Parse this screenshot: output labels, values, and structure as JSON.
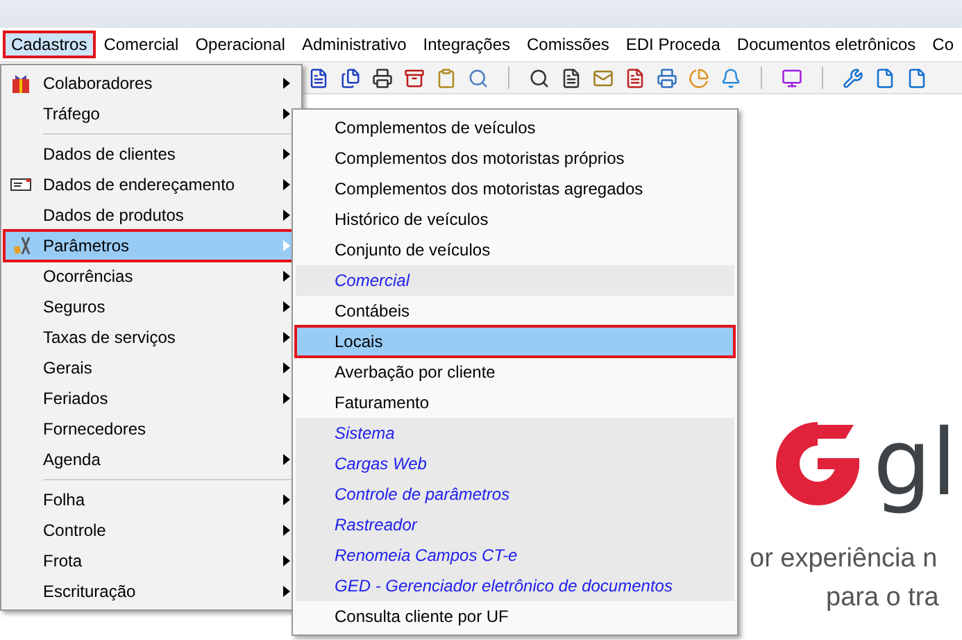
{
  "menubar": [
    {
      "label": "Cadastros",
      "selected": true
    },
    {
      "label": "Comercial",
      "selected": false
    },
    {
      "label": "Operacional",
      "selected": false
    },
    {
      "label": "Administrativo",
      "selected": false
    },
    {
      "label": "Integrações",
      "selected": false
    },
    {
      "label": "Comissões",
      "selected": false
    },
    {
      "label": "EDI Proceda",
      "selected": false
    },
    {
      "label": "Documentos eletrônicos",
      "selected": false
    },
    {
      "label": "Co",
      "selected": false
    }
  ],
  "menu": [
    {
      "kind": "item",
      "label": "Colaboradores",
      "submenu": true,
      "selected": false
    },
    {
      "kind": "item",
      "label": "Tráfego",
      "submenu": true,
      "selected": false
    },
    {
      "kind": "separator"
    },
    {
      "kind": "item",
      "label": "Dados de clientes",
      "submenu": true,
      "selected": false
    },
    {
      "kind": "item",
      "label": "Dados de endereçamento",
      "submenu": true,
      "selected": false
    },
    {
      "kind": "item",
      "label": "Dados de produtos",
      "submenu": true,
      "selected": false
    },
    {
      "kind": "item",
      "label": "Parâmetros",
      "submenu": true,
      "selected": true
    },
    {
      "kind": "item",
      "label": "Ocorrências",
      "submenu": true,
      "selected": false
    },
    {
      "kind": "item",
      "label": "Seguros",
      "submenu": true,
      "selected": false
    },
    {
      "kind": "item",
      "label": "Taxas de serviços",
      "submenu": true,
      "selected": false
    },
    {
      "kind": "item",
      "label": "Gerais",
      "submenu": true,
      "selected": false
    },
    {
      "kind": "item",
      "label": "Feriados",
      "submenu": true,
      "selected": false
    },
    {
      "kind": "item",
      "label": "Fornecedores",
      "submenu": false,
      "selected": false
    },
    {
      "kind": "item",
      "label": "Agenda",
      "submenu": true,
      "selected": false
    },
    {
      "kind": "separator"
    },
    {
      "kind": "item",
      "label": "Folha",
      "submenu": true,
      "selected": false
    },
    {
      "kind": "item",
      "label": "Controle",
      "submenu": true,
      "selected": false
    },
    {
      "kind": "item",
      "label": "Frota",
      "submenu": true,
      "selected": false
    },
    {
      "kind": "item",
      "label": "Escrituração",
      "submenu": true,
      "selected": false
    }
  ],
  "submenu": [
    {
      "kind": "item",
      "label": "Complementos de veículos",
      "selected": false
    },
    {
      "kind": "item",
      "label": "Complementos dos motoristas próprios",
      "selected": false
    },
    {
      "kind": "item",
      "label": "Complementos dos motoristas agregados",
      "selected": false
    },
    {
      "kind": "item",
      "label": "Histórico de veículos",
      "selected": false
    },
    {
      "kind": "item",
      "label": "Conjunto de veículos",
      "selected": false
    },
    {
      "kind": "group",
      "label": "Comercial"
    },
    {
      "kind": "item",
      "label": "Contábeis",
      "selected": false
    },
    {
      "kind": "item",
      "label": "Locais",
      "selected": true
    },
    {
      "kind": "item",
      "label": "Averbação por cliente",
      "selected": false
    },
    {
      "kind": "item",
      "label": "Faturamento",
      "selected": false
    },
    {
      "kind": "group",
      "label": "Sistema"
    },
    {
      "kind": "group",
      "label": "Cargas Web"
    },
    {
      "kind": "group",
      "label": "Controle de parâmetros"
    },
    {
      "kind": "group",
      "label": "Rastreador"
    },
    {
      "kind": "group",
      "label": "Renomeia Campos CT-e"
    },
    {
      "kind": "group",
      "label": "GED - Gerenciador eletrônico de documentos"
    },
    {
      "kind": "item",
      "label": "Consulta cliente por UF",
      "selected": false
    }
  ],
  "welcome": {
    "logo_text": "gl",
    "lines": [
      "or experiência n",
      "para o tra"
    ]
  }
}
